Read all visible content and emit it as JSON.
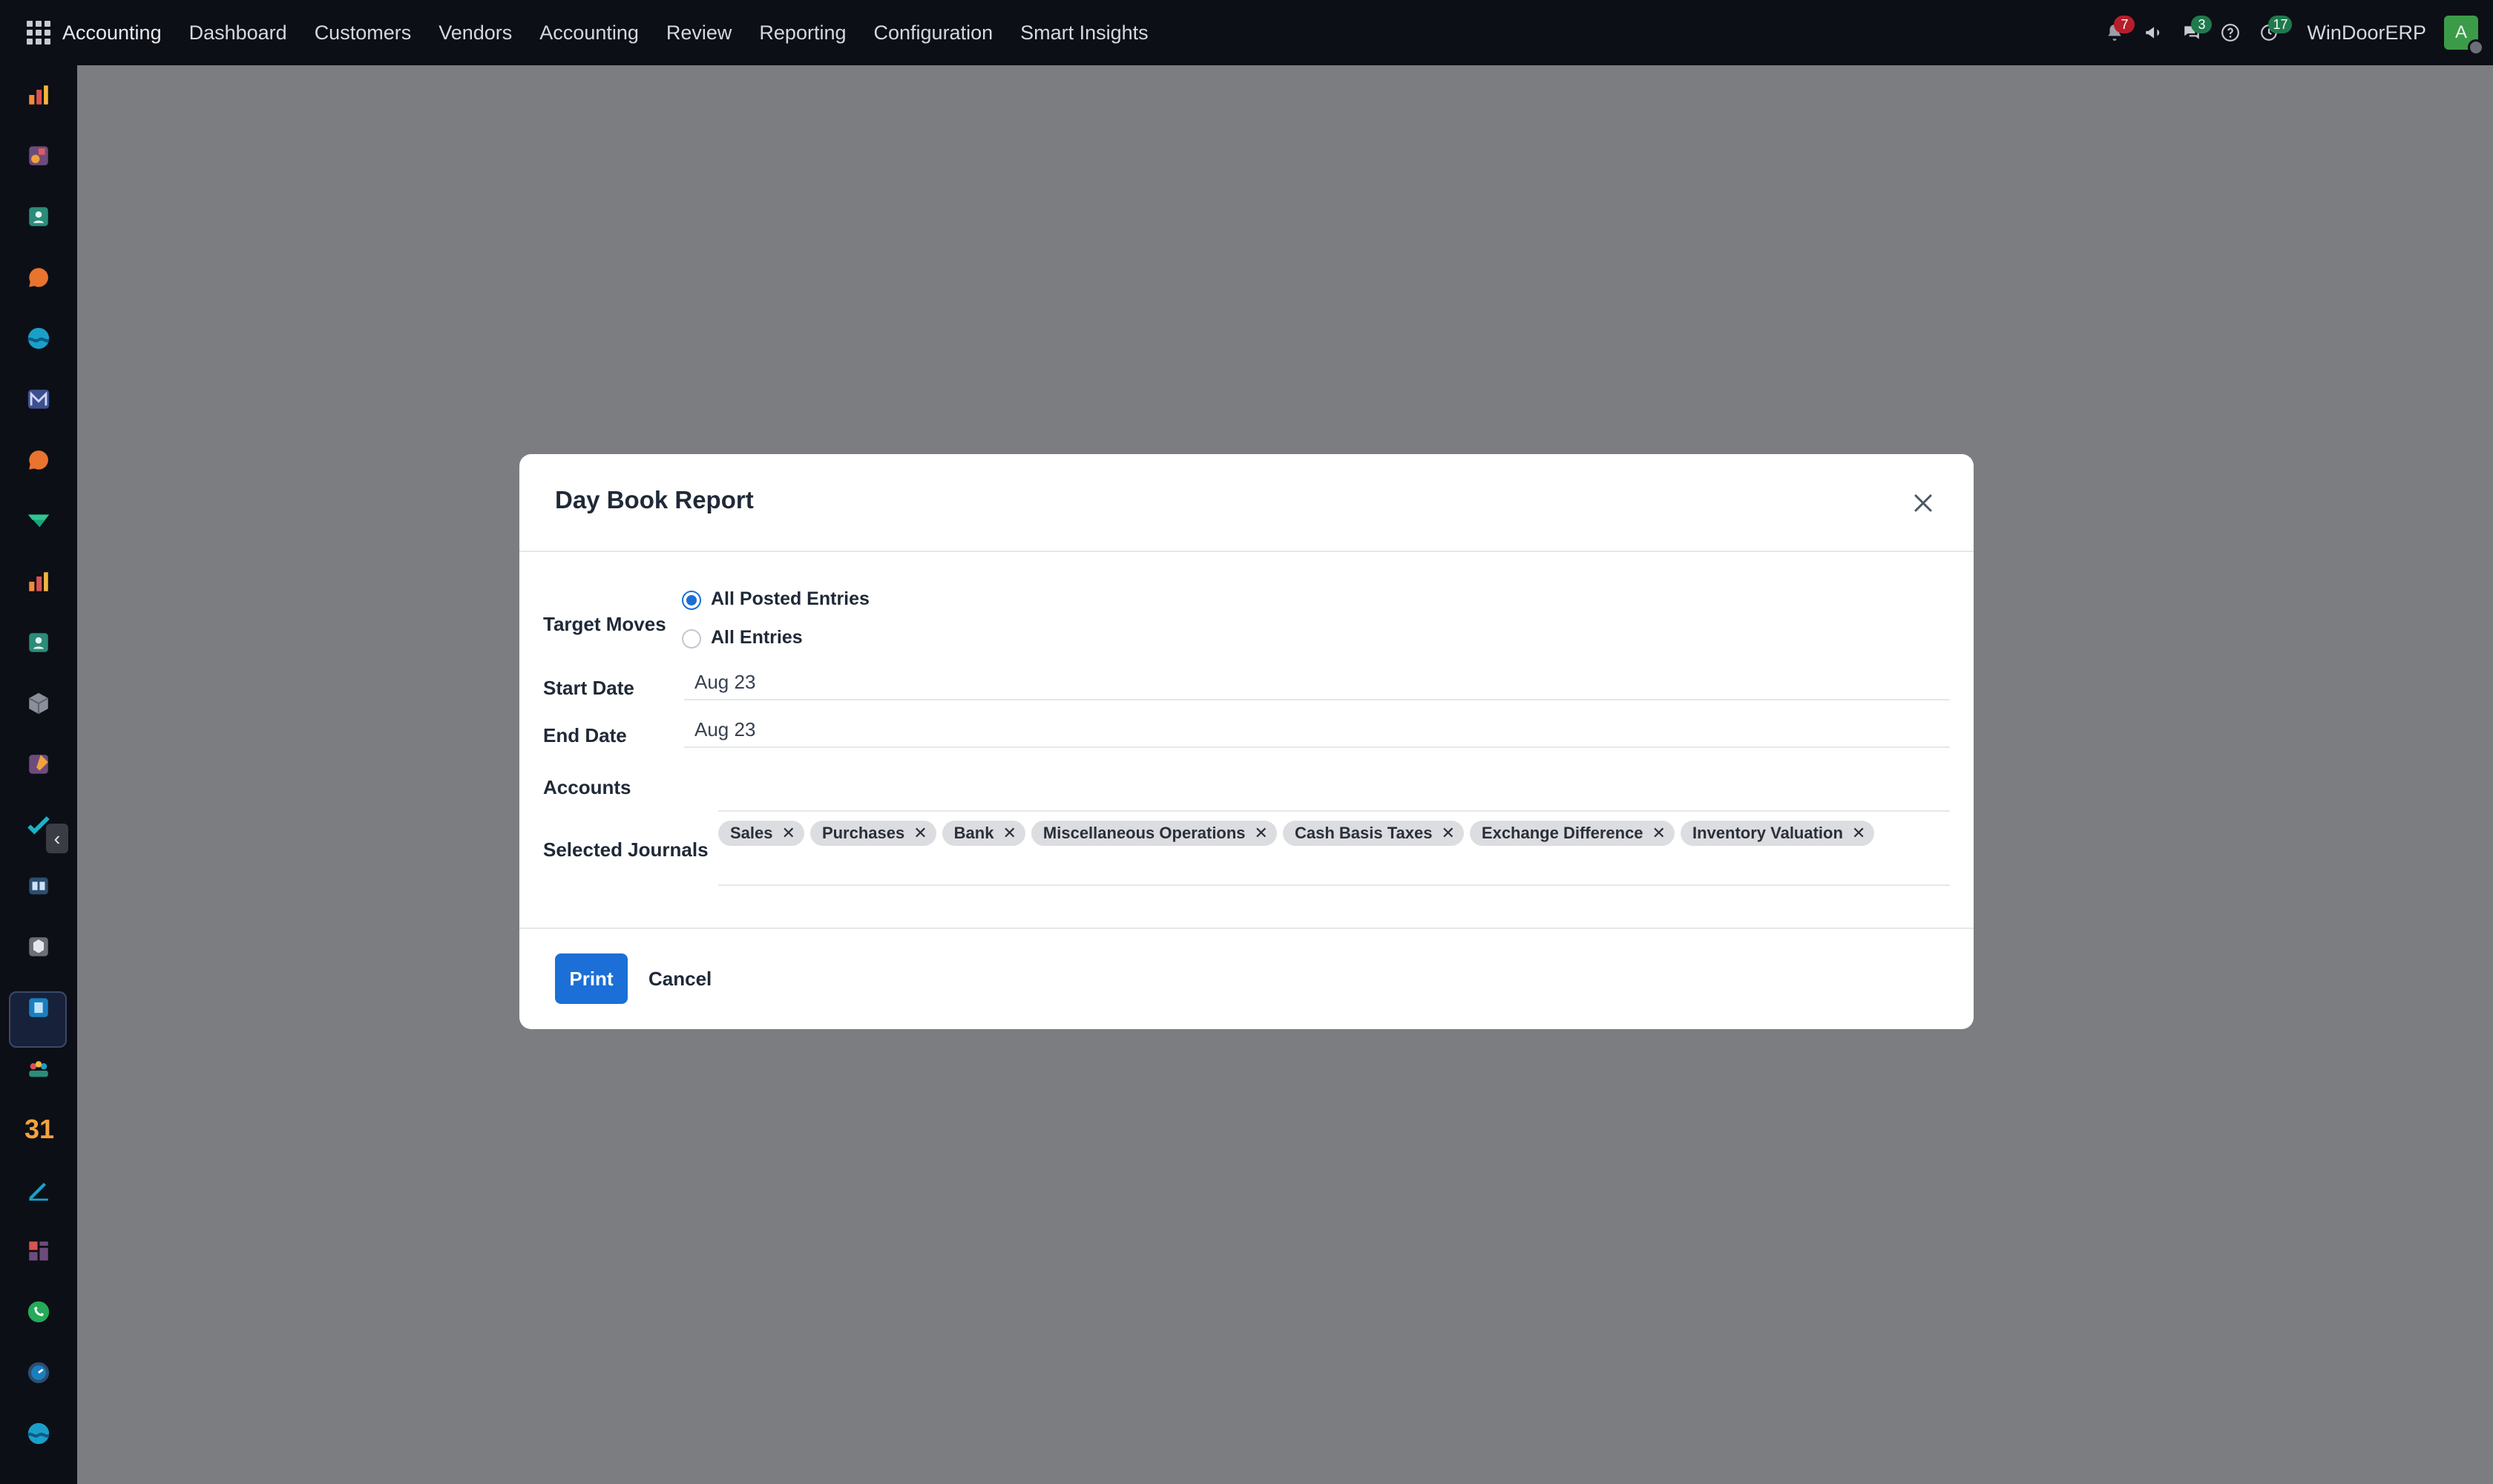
{
  "topbar": {
    "brand": "Accounting",
    "menu": [
      "Dashboard",
      "Customers",
      "Vendors",
      "Accounting",
      "Review",
      "Reporting",
      "Configuration",
      "Smart Insights"
    ],
    "notifications_badge": "7",
    "messages_badge": "3",
    "activity_badge": "17",
    "company": "WinDoorERP",
    "avatar_letter": "A"
  },
  "sidebar": {
    "icons": [
      "chart-icon",
      "apps-icon",
      "contacts-icon",
      "chat-icon",
      "wave-icon",
      "mail-icon",
      "chat-icon",
      "check-icon",
      "chart-icon",
      "contacts-icon",
      "cube-icon",
      "puzzle-icon",
      "task-icon",
      "book-icon",
      "inventory-icon",
      "accounting-icon",
      "team-icon",
      "calendar-icon",
      "sign-icon",
      "dashboard-icon",
      "whatsapp-icon",
      "clock-icon",
      "wave-icon"
    ],
    "calendar_day": "31"
  },
  "modal": {
    "title": "Day Book Report",
    "target_moves_label": "Target Moves",
    "radio_options": [
      "All Posted Entries",
      "All Entries"
    ],
    "selected_option": "All Posted Entries",
    "start_date_label": "Start Date",
    "start_date_value": "Aug 23",
    "end_date_label": "End Date",
    "end_date_value": "Aug 23",
    "accounts_label": "Accounts",
    "journals_label": "Selected Journals",
    "journals": [
      "Sales",
      "Purchases",
      "Bank",
      "Miscellaneous Operations",
      "Cash Basis Taxes",
      "Exchange Difference",
      "Inventory Valuation"
    ],
    "print_label": "Print",
    "cancel_label": "Cancel"
  },
  "colors": {
    "primary": "#1b6fd6",
    "topbar_bg": "#0d0f16",
    "backdrop": "#7c7d80"
  }
}
